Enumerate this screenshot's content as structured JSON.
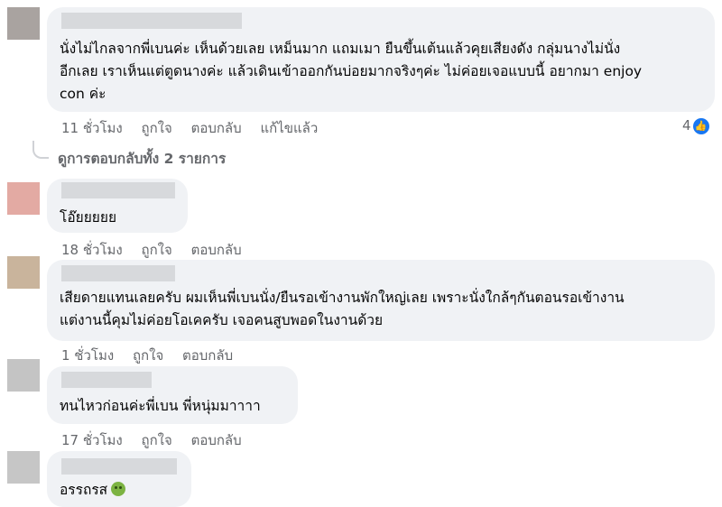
{
  "comments": [
    {
      "lines": [
        "นั่งไม่ไกลจากพี่เบนค่ะ เห็นด้วยเลย เหม็นมาก แถมเมา ยืนขึ้นเต้นแล้วคุยเสียงดัง กลุ่มนางไม่นั่ง",
        "อีกเลย เราเห็นแต่ตูดนางค่ะ แล้วเดินเข้าออกกันบ่อยมากจริงๆค่ะ ไม่ค่อยเจอแบบนี้ อยากมา enjoy",
        "con ค่ะ"
      ],
      "time": "11 ชั่วโมง",
      "like": "ถูกใจ",
      "reply": "ตอบกลับ",
      "edited": "แก้ไขแล้ว",
      "reaction_count": "4"
    },
    {
      "lines": [
        "โอ๊ยยยยย"
      ],
      "time": "18 ชั่วโมง",
      "like": "ถูกใจ",
      "reply": "ตอบกลับ"
    },
    {
      "lines": [
        "เสียดายแทนเลยครับ ผมเห็นพี่เบนนั่ง/ยืนรอเข้างานพักใหญ่เลย เพราะนั่งใกล้ๆกันตอนรอเข้างาน",
        "แต่งานนี้คุมไม่ค่อยโอเคครับ เจอคนสูบพอดในงานด้วย"
      ],
      "time": "1 ชั่วโมง",
      "like": "ถูกใจ",
      "reply": "ตอบกลับ"
    },
    {
      "lines": [
        "ทนไหวก่อนค่ะพี่เบน พี่หนุ่มมาาาา"
      ],
      "time": "17 ชั่วโมง",
      "like": "ถูกใจ",
      "reply": "ตอบกลับ"
    },
    {
      "lines": [
        "อรรถรส"
      ],
      "time": "",
      "like": "",
      "reply": ""
    }
  ],
  "view_replies": "ดูการตอบกลับทั้ง 2 รายการ",
  "icons": {
    "like_badge": "like-thumb-icon",
    "emoji": "nauseated-face-icon",
    "replies_arrow": "reply-arrow-icon"
  },
  "colors": {
    "bubble": "#f0f2f5",
    "meta_text": "#65676b",
    "like_blue": "#1877f2"
  }
}
